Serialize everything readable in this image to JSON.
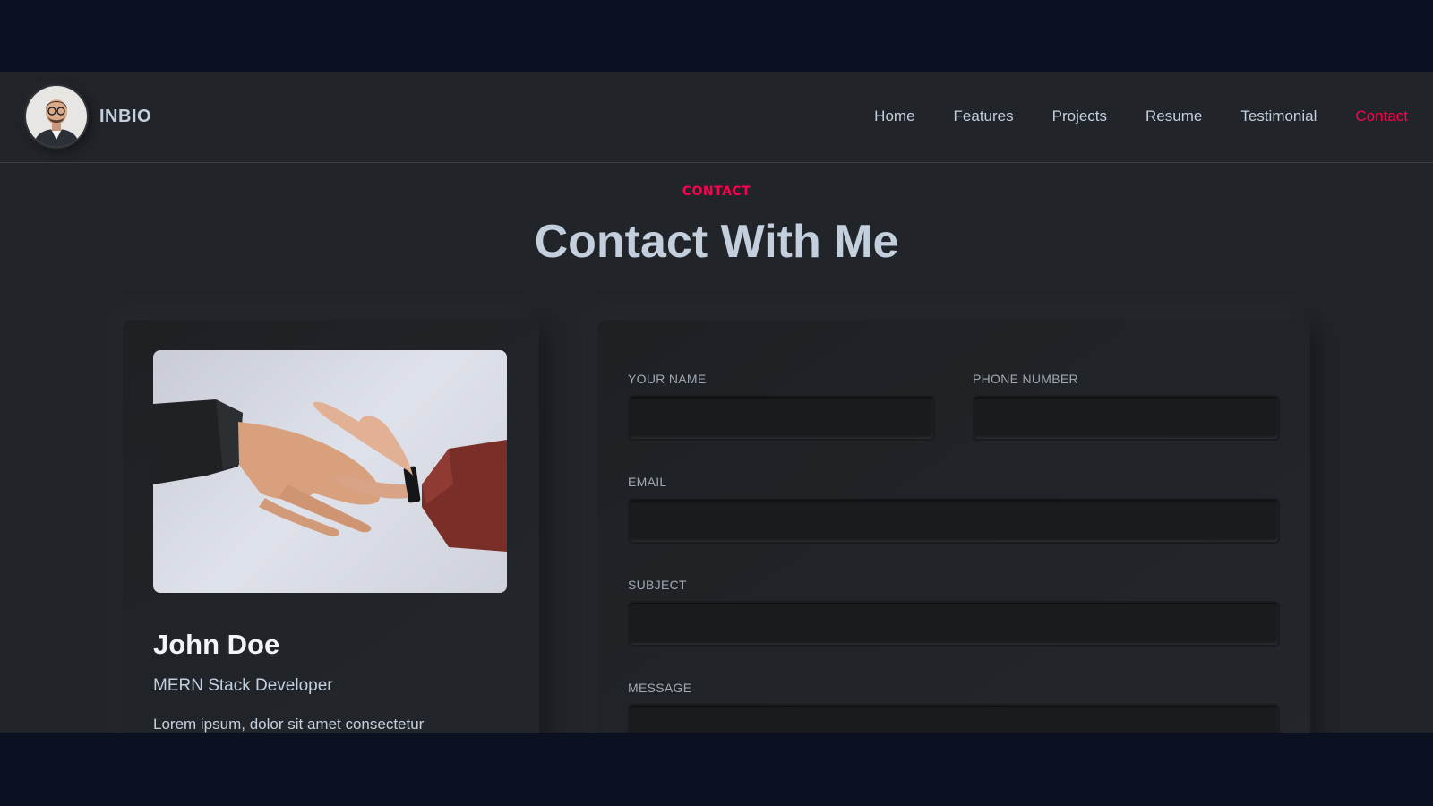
{
  "header": {
    "brand_name": "INBIO",
    "avatar_icon": "profile-photo",
    "nav": [
      {
        "label": "Home"
      },
      {
        "label": "Features"
      },
      {
        "label": "Projects"
      },
      {
        "label": "Resume"
      },
      {
        "label": "Testimonial"
      },
      {
        "label": "Contact",
        "active": true
      }
    ]
  },
  "section": {
    "tag": "CONTACT",
    "title": "Contact With Me"
  },
  "profile": {
    "photo_icon": "handshake-photo",
    "name": "John Doe",
    "role": "MERN Stack Developer",
    "description": "Lorem ipsum, dolor sit amet consectetur"
  },
  "form": {
    "name_label": "YOUR NAME",
    "name_value": "",
    "phone_label": "PHONE NUMBER",
    "phone_value": "",
    "email_label": "EMAIL",
    "email_value": "",
    "subject_label": "SUBJECT",
    "subject_value": "",
    "message_label": "MESSAGE",
    "message_value": ""
  },
  "colors": {
    "accent": "#ff014f",
    "background": "#212428",
    "text": "#c4cfde",
    "outer_background": "#0b1120"
  }
}
